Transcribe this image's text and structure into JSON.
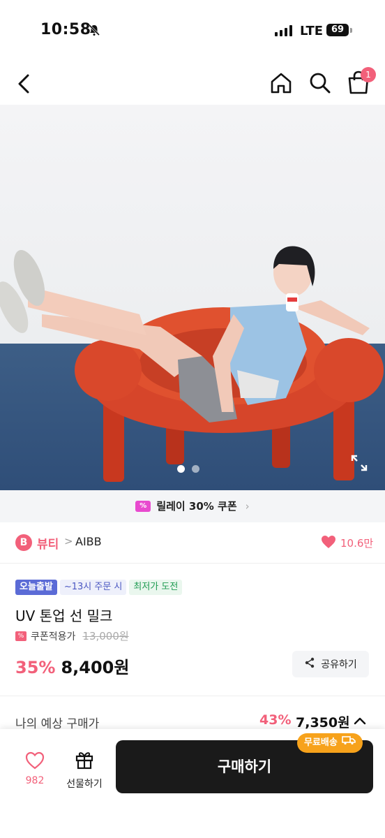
{
  "status": {
    "time": "10:58",
    "network": "LTE",
    "battery": "69"
  },
  "nav": {
    "cart_count": "1"
  },
  "hero": {
    "page_count": 2,
    "active_page": 1
  },
  "coupon_strip": {
    "label": "릴레이 30% 쿠폰",
    "tag": "%"
  },
  "brand_row": {
    "badge": "B",
    "category": "뷰티",
    "separator": ">",
    "brand": "AIBB",
    "likes": "10.6만"
  },
  "chips": [
    "오늘출발",
    "~13시 주문 시",
    "최저가 도전"
  ],
  "product": {
    "title": "UV 톤업 선 밀크",
    "coupon_label": "쿠폰적용가",
    "original_price": "13,000원",
    "discount": "35%",
    "price": "8,400원"
  },
  "share": {
    "label": "공유하기"
  },
  "expected": {
    "label": "나의 예상 구매가",
    "discount": "43%",
    "price": "7,350원"
  },
  "bottom_bar": {
    "wish_count": "982",
    "gift_label": "선물하기",
    "buy_label": "구매하기",
    "free_shipping": "무료배송"
  },
  "colors": {
    "accent": "#f2607a",
    "buy_bg": "#1a1a1a",
    "free_ship": "#f7a21b",
    "chip_blue": "#5b6bd6"
  }
}
